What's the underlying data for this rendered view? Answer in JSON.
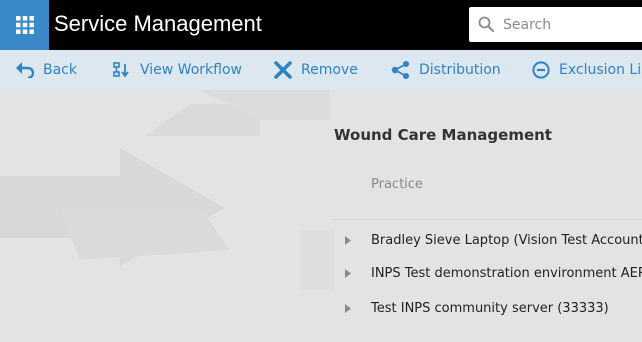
{
  "header": {
    "title": "Service Management",
    "apps_icon": "grid-apps-icon",
    "search": {
      "placeholder": "Search",
      "value": ""
    }
  },
  "toolbar": {
    "items": [
      {
        "label": "Back",
        "icon": "back-arrow-icon"
      },
      {
        "label": "View Workflow",
        "icon": "workflow-icon"
      },
      {
        "label": "Remove",
        "icon": "close-x-icon"
      },
      {
        "label": "Distribution",
        "icon": "share-icon"
      },
      {
        "label": "Exclusion List",
        "icon": "minus-circle-icon"
      }
    ]
  },
  "main": {
    "section_title": "Wound Care Management",
    "column_header": "Practice",
    "rows": [
      {
        "label": "Bradley Sieve Laptop (Vision Test Account) ("
      },
      {
        "label": "INPS Test demonstration environment AERO"
      },
      {
        "label": "Test INPS community server (33333)"
      }
    ]
  },
  "colors": {
    "header_bg": "#000000",
    "apps_button_bg": "#3a88c8",
    "toolbar_bg": "#dde7f0",
    "accent": "#2e84c6",
    "content_bg": "#e3e3e3"
  }
}
